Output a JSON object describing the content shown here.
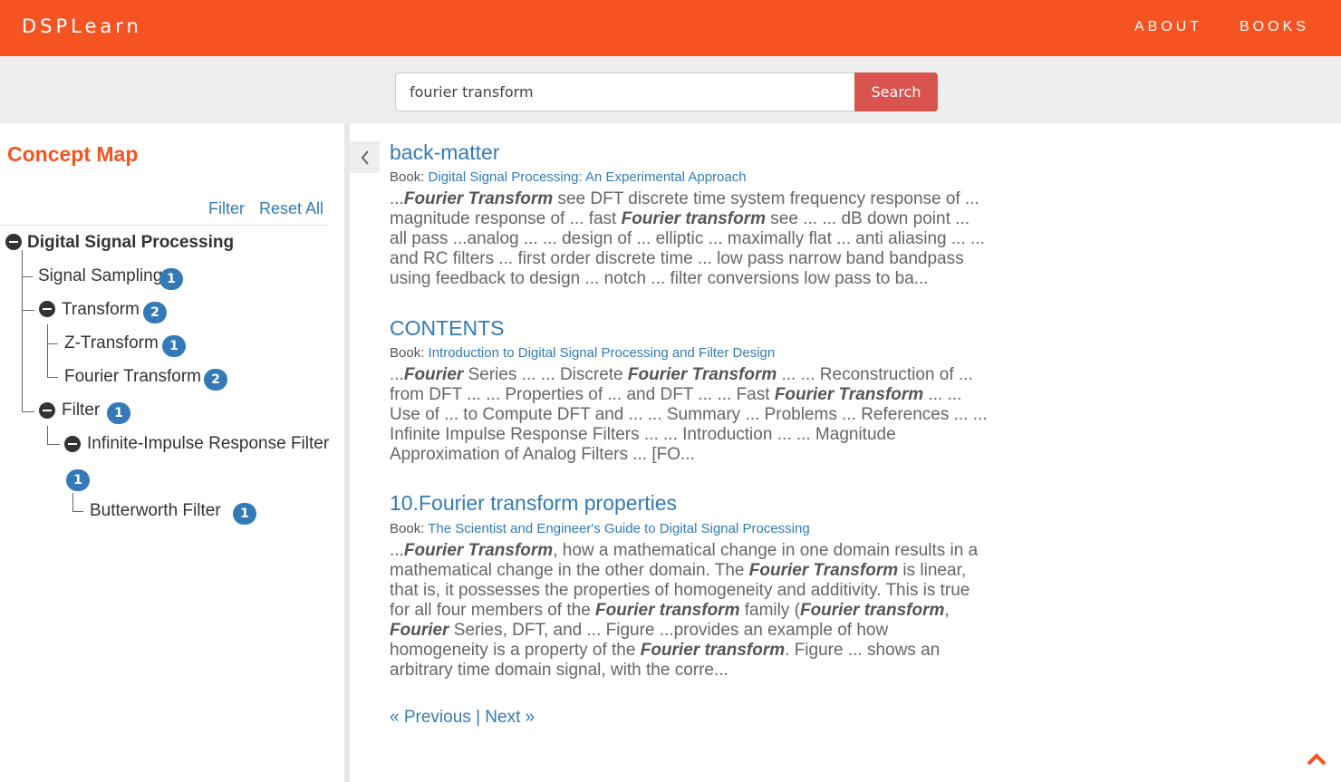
{
  "navbar": {
    "brand": "DSPLearn",
    "links": [
      "ABOUT",
      "BOOKS"
    ],
    "accent_color": "#f55322"
  },
  "search": {
    "value": "fourier transform",
    "button_label": "Search"
  },
  "sidebar": {
    "title": "Concept Map",
    "filter_label": "Filter",
    "reset_label": "Reset All",
    "tree": {
      "root": "Digital Signal Processing",
      "signal_sampling": {
        "label": "Signal Sampling",
        "count": "1"
      },
      "transform": {
        "label": "Transform",
        "count": "2"
      },
      "z_transform": {
        "label": "Z-Transform",
        "count": "1"
      },
      "fourier_transform": {
        "label": "Fourier Transform",
        "count": "2"
      },
      "filter": {
        "label": "Filter",
        "count": "1"
      },
      "iir_filter": {
        "label": "Infinite-Impulse Response Filter",
        "count": "1"
      },
      "butterworth_filter": {
        "label": "Butterworth Filter",
        "count": "1"
      }
    }
  },
  "collapse_icon": "chevron-left-icon",
  "results": [
    {
      "title": "back-matter",
      "book_prefix": "Book:",
      "book": "Digital Signal Processing: An Experimental Approach",
      "snippet": [
        {
          "t": "..."
        },
        {
          "t": "Fourier Transform",
          "em": true
        },
        {
          "t": " see DFT discrete time system frequency response of ... magnitude response of ... fast "
        },
        {
          "t": "Fourier transform",
          "em": true
        },
        {
          "t": " see ... ... dB down point ... all pass ...analog ... ... design of ... elliptic ... maximally flat ... anti aliasing ... ... and RC filters ... first order discrete time ... low pass narrow band bandpass using feedback to design ... notch ... filter conversions low pass to ba..."
        }
      ]
    },
    {
      "title": "CONTENTS",
      "book_prefix": "Book:",
      "book": "Introduction to Digital Signal Processing and Filter Design",
      "snippet": [
        {
          "t": "..."
        },
        {
          "t": "Fourier",
          "em": true
        },
        {
          "t": " Series ... ... Discrete "
        },
        {
          "t": "Fourier Transform",
          "em": true
        },
        {
          "t": " ... ... Reconstruction of ... from DFT ... ... Properties of ... and DFT ... ... Fast "
        },
        {
          "t": "Fourier Transform",
          "em": true
        },
        {
          "t": " ... ... Use of ... to Compute DFT and ... ... Summary ... Problems ... References ... ... Infinite Impulse Response Filters ... ... Introduction ... ... Magnitude Approximation of Analog Filters ... [FO..."
        }
      ]
    },
    {
      "title": "10.Fourier transform properties",
      "book_prefix": "Book:",
      "book": "The Scientist and Engineer's Guide to Digital Signal Processing",
      "snippet": [
        {
          "t": "..."
        },
        {
          "t": "Fourier Transform",
          "em": true
        },
        {
          "t": ", how a mathematical change in one domain results in a mathematical change in the other domain. The "
        },
        {
          "t": "Fourier Transform",
          "em": true
        },
        {
          "t": " is linear, that is, it possesses the properties of homogeneity and additivity. This is true for all four members of the "
        },
        {
          "t": "Fourier transform",
          "em": true
        },
        {
          "t": " family ("
        },
        {
          "t": "Fourier transform",
          "em": true
        },
        {
          "t": ", "
        },
        {
          "t": "Fourier",
          "em": true
        },
        {
          "t": " Series, DFT, and ... Figure ...provides an example of how homogeneity is a property of the "
        },
        {
          "t": "Fourier transform",
          "em": true
        },
        {
          "t": ". Figure ... shows an arbitrary time domain signal, with the corre..."
        }
      ]
    }
  ],
  "pagination": {
    "previous": "« Previous",
    "separator": "|",
    "next": "Next »"
  },
  "back_to_top_icon": "chevron-up-icon"
}
